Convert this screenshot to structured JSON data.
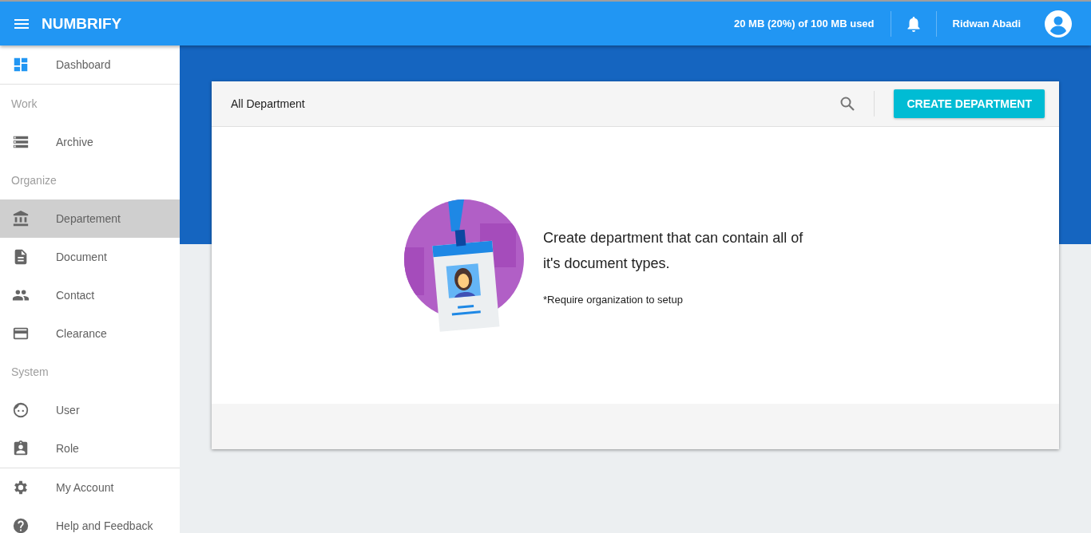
{
  "app_bar": {
    "brand": "NUMBRIFY",
    "storage": "20 MB (20%) of 100 MB used",
    "user_name": "Ridwan Abadi"
  },
  "sidebar": {
    "sections": [
      {
        "items": [
          {
            "label": "Dashboard",
            "selected": false
          }
        ]
      },
      {
        "heading": "Work",
        "items": [
          {
            "label": "Archive",
            "selected": false
          }
        ]
      },
      {
        "heading": "Organize",
        "items": [
          {
            "label": "Departement",
            "selected": true
          },
          {
            "label": "Document",
            "selected": false
          },
          {
            "label": "Contact",
            "selected": false
          },
          {
            "label": "Clearance",
            "selected": false
          }
        ]
      },
      {
        "heading": "System",
        "items": [
          {
            "label": "User",
            "selected": false
          },
          {
            "label": "Role",
            "selected": false
          }
        ]
      },
      {
        "items": [
          {
            "label": "My Account",
            "selected": false
          },
          {
            "label": "Help and Feedback",
            "selected": false
          }
        ]
      }
    ]
  },
  "card": {
    "title": "All Department",
    "button": "CREATE DEPARTMENT",
    "empty_state": {
      "message": "Create department that can contain all of it's document types.",
      "note": "*Require organization to setup"
    }
  }
}
